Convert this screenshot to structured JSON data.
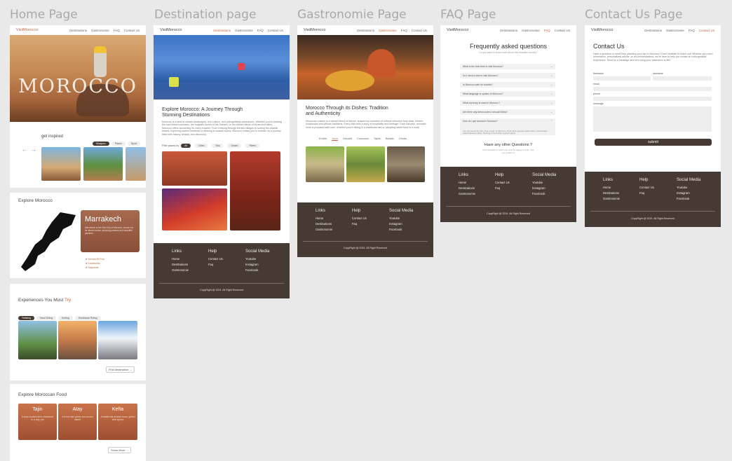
{
  "page_titles": [
    "Home Page",
    "Destination page",
    "Gastronomie Page",
    "FAQ Page",
    "Contact Us Page"
  ],
  "brand": "VisitMorocco",
  "nav": {
    "home": [
      "Destinations",
      "Gastronomie",
      "FAQ",
      "Contact Us"
    ],
    "dest": [
      "Destinations",
      "Gastronomie",
      "FAQ",
      "Contact Us"
    ],
    "gastro": [
      "Destinations",
      "Gastronomie",
      "FAQ",
      "Contact Us"
    ],
    "faq": [
      "Destinations",
      "Gastronomie",
      "FAQ",
      "Contact Us"
    ],
    "contact": [
      "Destinations",
      "Gastronomie",
      "FAQ",
      "Contact Us"
    ]
  },
  "home": {
    "hero_title": "MOROCCO",
    "inspired_label": "get inspired",
    "inspired_tabs": [
      "Mosques",
      "Places",
      "Sport"
    ],
    "explore_title": "Explore Morocco",
    "city_title": "Marrakech",
    "city_text": "Marrakech is the Red City of Morocco, known for its vibrant souks, stunning palaces and beautiful gardens.",
    "city_list": [
      "Jemaa El Fna",
      "Koutoubia",
      "Majorelle"
    ],
    "experiences_title": "Experiences You Must",
    "experiences_accent": "Try",
    "experience_tabs": [
      "Trekking",
      "Sand Skiing",
      "Surfing",
      "Horseback Riding"
    ],
    "find_button": "Find destination →",
    "food_title": "Explore Moroccan Food",
    "foods": [
      {
        "name": "Tajin",
        "desc": "A slow-cooked stew simmered in a clay pot"
      },
      {
        "name": "Atay",
        "desc": "A fresh mint green tea served sweet"
      },
      {
        "name": "Kefta",
        "desc": "A traditional minced meat, grilled with spices"
      }
    ],
    "show_more": "Show More →"
  },
  "destination": {
    "title_line1": "Explore Morocco: A Journey Through",
    "title_line2": "Stunning Destinations",
    "intro": "Morocco is a land of vibrant landscapes, rich culture, and unforgettable adventures. Whether you're seeking the lush Atlas mountains, the majestic dunes of the Sahara, or the vibrant alleys of its ancient cities, Morocco offers something for every traveler. From trekking through Berber villages to surfing the Atlantic waves, exploring ancient medinas or relaxing in coastal towns, Morocco invites you to embark on a journey filled with history, beauty, and discovery.",
    "filter_label": "Filter places by",
    "filters": [
      "All",
      "Cities",
      "Sea",
      "Desert",
      "Rivers"
    ]
  },
  "gastro": {
    "title_line1": "Morocco Through its Dishes: Tradition",
    "title_line2": "and Authenticity",
    "intro": "Moroccan cuisine is a vibrant blend of flavors, shaped by centuries of cultural influence from Arab, Berber, Andalusian and African traditions. Every dish tells a story of hospitality and heritage. Each flavorful, aromatic meal is prepared with care, whether you're dining in a traditional riad or sampling street food in a souk.",
    "tabs": [
      "Entrée",
      "Juice",
      "Dessert",
      "Couscous",
      "Tajine",
      "Breads",
      "Drinks"
    ],
    "active_tab": 1
  },
  "faq": {
    "title": "Frequently asked questions",
    "subtitle": "Do you want to know more about this beautiful country?",
    "questions": [
      "What is the best time to visit Morocco?",
      "Do I need a visa to visit Morocco?",
      "Is Morocco safe for tourists?",
      "What language is spoken in Morocco?",
      "What currency is used in Morocco?",
      "Are there any dress codes I should follow?",
      "How do I get around in Morocco?"
    ],
    "answer": "You can travel by train, bus or taxi. In Morocco, Petit taxis operate within cities, Grand taxis travel between cities. Renting a car is also a great option.",
    "more_title": "Have any other Questions ?",
    "more_text": "Don't hesitate to reach out, we'd be happy to help. Visit our contact us"
  },
  "contact": {
    "title": "Contact Us",
    "intro": "Have a question or need help planning your trip to Morocco? Don't hesitate to reach out! Whether you need information, personalized advice, or recommendations, we're here to help you create an unforgettable experience. Send us a message and let's bring your adventure to life!",
    "firstname": "firstname",
    "lastname": "lastname",
    "email": "email",
    "phone": "phone",
    "message": "message",
    "submit": "submit"
  },
  "footer": {
    "links_head": "Links",
    "links": [
      "Home",
      "Destinations",
      "Gastronomie"
    ],
    "help_head": "Help",
    "help": [
      "Contact Us",
      "Faq"
    ],
    "social_head": "Social Media",
    "social": [
      "Youtube",
      "Instagram",
      "Facebook"
    ],
    "copyright": "CopyRight @ 2024. All Right Reserved"
  },
  "colors": {
    "accent": "#c4643a",
    "footer": "#463a35",
    "background": "#e9e9e9"
  }
}
